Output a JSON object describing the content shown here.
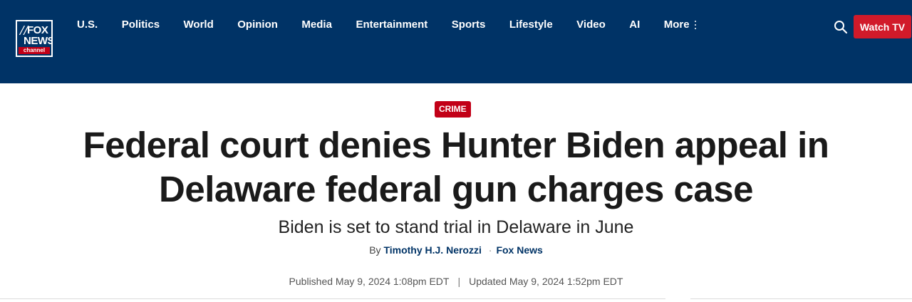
{
  "brand": {
    "logo_text_top": "FOX",
    "logo_text_bottom": "NEWS",
    "logo_text_channel": "channel",
    "logo_icon": "fox-news-logo"
  },
  "nav": {
    "items": [
      {
        "label": "U.S."
      },
      {
        "label": "Politics"
      },
      {
        "label": "World"
      },
      {
        "label": "Opinion"
      },
      {
        "label": "Media"
      },
      {
        "label": "Entertainment"
      },
      {
        "label": "Sports"
      },
      {
        "label": "Lifestyle"
      },
      {
        "label": "Video"
      },
      {
        "label": "AI"
      }
    ],
    "more_label": "More",
    "more_icon": "kebab-icon"
  },
  "header_actions": {
    "search_icon": "search-icon",
    "watch_label": "Watch TV"
  },
  "article": {
    "eyebrow": "CRIME",
    "headline": "Federal court denies Hunter Biden appeal in Delaware federal gun charges case",
    "subhead": "Biden is set to stand trial in Delaware in June",
    "byline_prefix": "By",
    "author": "Timothy H.J. Nerozzi",
    "byline_separator": "·",
    "source": "Fox News",
    "published": "Published May 9, 2024 1:08pm EDT",
    "date_separator": "|",
    "updated": "Updated May 9, 2024 1:52pm EDT"
  },
  "colors": {
    "header_bg": "#003366",
    "accent_red": "#c20017",
    "watch_button": "#d11a2a"
  }
}
